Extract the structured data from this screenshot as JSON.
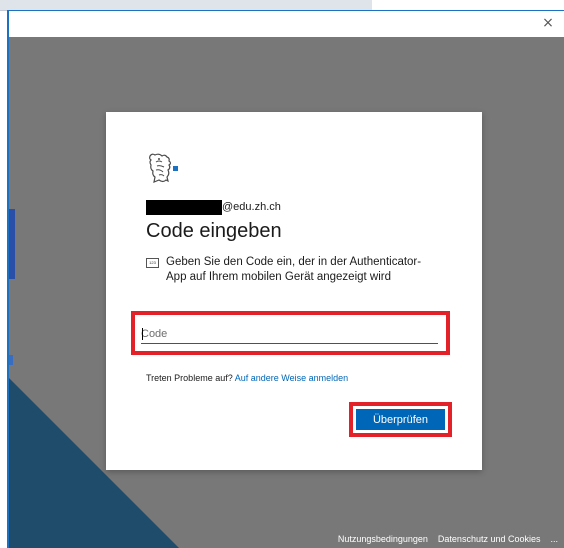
{
  "window": {
    "close_label": "×"
  },
  "dialog": {
    "email_suffix": "@edu.zh.ch",
    "title": "Code eingeben",
    "description": "Geben Sie den Code ein, der in der Authenticator-App auf Ihrem mobilen Gerät angezeigt wird",
    "code_input": {
      "placeholder": "Code",
      "value": ""
    },
    "trouble_text": "Treten Probleme auf?",
    "trouble_link": "Auf andere Weise anmelden",
    "verify_button": "Überprüfen"
  },
  "footer": {
    "terms": "Nutzungsbedingungen",
    "privacy": "Datenschutz und Cookies",
    "more": "..."
  },
  "colors": {
    "accent": "#0067b8",
    "highlight": "#e32128",
    "backdrop": "#787878",
    "window_border": "#1b72c2"
  }
}
